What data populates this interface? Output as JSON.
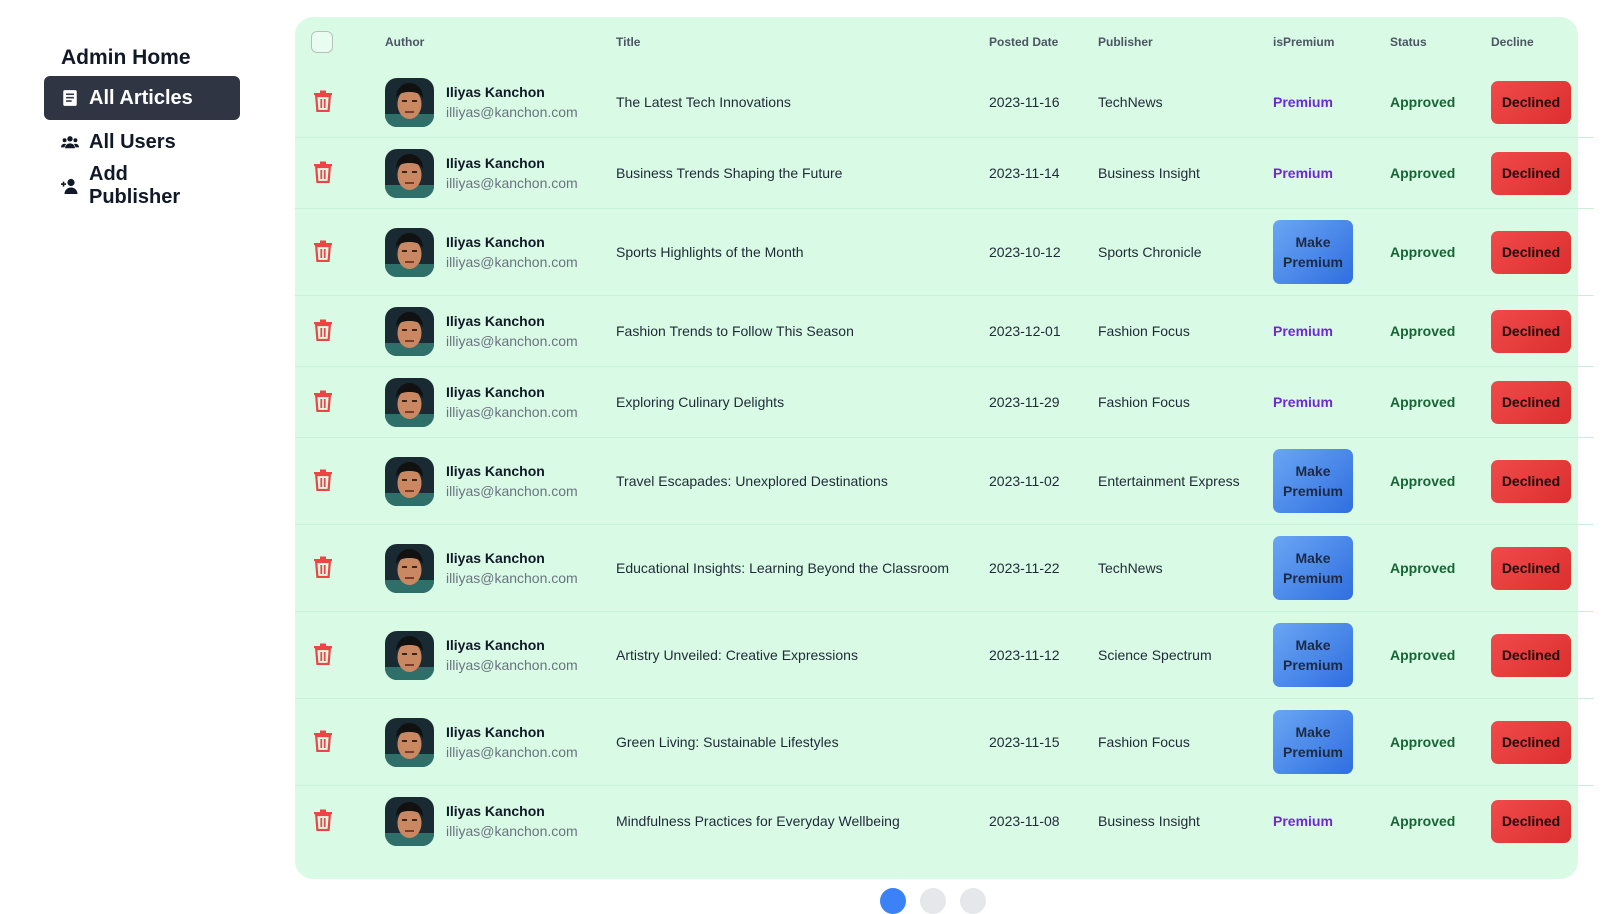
{
  "sidebar": {
    "title": "Admin Home",
    "items": [
      {
        "label": "All Articles",
        "icon": "article-icon",
        "active": true
      },
      {
        "label": "All Users",
        "icon": "users-icon",
        "active": false
      },
      {
        "label": "Add Publisher",
        "icon": "add-user-icon",
        "active": false
      }
    ]
  },
  "table": {
    "headers": {
      "author": "Author",
      "title": "Title",
      "posted_date": "Posted Date",
      "publisher": "Publisher",
      "is_premium": "isPremium",
      "status": "Status",
      "decline": "Decline"
    },
    "premium_label": "Premium",
    "make_premium_label": "Make Premium",
    "rows": [
      {
        "author_name": "Iliyas Kanchon",
        "author_email": "illiyas@kanchon.com",
        "title": "The Latest Tech Innovations",
        "date": "2023-11-16",
        "publisher": "TechNews",
        "premium": true,
        "status": "Approved",
        "decline": "Declined"
      },
      {
        "author_name": "Iliyas Kanchon",
        "author_email": "illiyas@kanchon.com",
        "title": "Business Trends Shaping the Future",
        "date": "2023-11-14",
        "publisher": "Business Insight",
        "premium": true,
        "status": "Approved",
        "decline": "Declined"
      },
      {
        "author_name": "Iliyas Kanchon",
        "author_email": "illiyas@kanchon.com",
        "title": "Sports Highlights of the Month",
        "date": "2023-10-12",
        "publisher": "Sports Chronicle",
        "premium": false,
        "status": "Approved",
        "decline": "Declined"
      },
      {
        "author_name": "Iliyas Kanchon",
        "author_email": "illiyas@kanchon.com",
        "title": "Fashion Trends to Follow This Season",
        "date": "2023-12-01",
        "publisher": "Fashion Focus",
        "premium": true,
        "status": "Approved",
        "decline": "Declined"
      },
      {
        "author_name": "Iliyas Kanchon",
        "author_email": "illiyas@kanchon.com",
        "title": "Exploring Culinary Delights",
        "date": "2023-11-29",
        "publisher": "Fashion Focus",
        "premium": true,
        "status": "Approved",
        "decline": "Declined"
      },
      {
        "author_name": "Iliyas Kanchon",
        "author_email": "illiyas@kanchon.com",
        "title": "Travel Escapades: Unexplored Destinations",
        "date": "2023-11-02",
        "publisher": "Entertainment Express",
        "premium": false,
        "status": "Approved",
        "decline": "Declined"
      },
      {
        "author_name": "Iliyas Kanchon",
        "author_email": "illiyas@kanchon.com",
        "title": "Educational Insights: Learning Beyond the Classroom",
        "date": "2023-11-22",
        "publisher": "TechNews",
        "premium": false,
        "status": "Approved",
        "decline": "Declined"
      },
      {
        "author_name": "Iliyas Kanchon",
        "author_email": "illiyas@kanchon.com",
        "title": "Artistry Unveiled: Creative Expressions",
        "date": "2023-11-12",
        "publisher": "Science Spectrum",
        "premium": false,
        "status": "Approved",
        "decline": "Declined"
      },
      {
        "author_name": "Iliyas Kanchon",
        "author_email": "illiyas@kanchon.com",
        "title": "Green Living: Sustainable Lifestyles",
        "date": "2023-11-15",
        "publisher": "Fashion Focus",
        "premium": false,
        "status": "Approved",
        "decline": "Declined"
      },
      {
        "author_name": "Iliyas Kanchon",
        "author_email": "illiyas@kanchon.com",
        "title": "Mindfulness Practices for Everyday Wellbeing",
        "date": "2023-11-08",
        "publisher": "Business Insight",
        "premium": true,
        "status": "Approved",
        "decline": "Declined"
      }
    ]
  },
  "colors": {
    "panel_bg": "#d9fbe6",
    "active_nav_bg": "#2f3542",
    "premium_text": "#6d28d9",
    "approved_text": "#166534",
    "decline_button": "#e53e3e",
    "make_premium_button": "#3b82f6",
    "trash_icon": "#ef4444"
  }
}
